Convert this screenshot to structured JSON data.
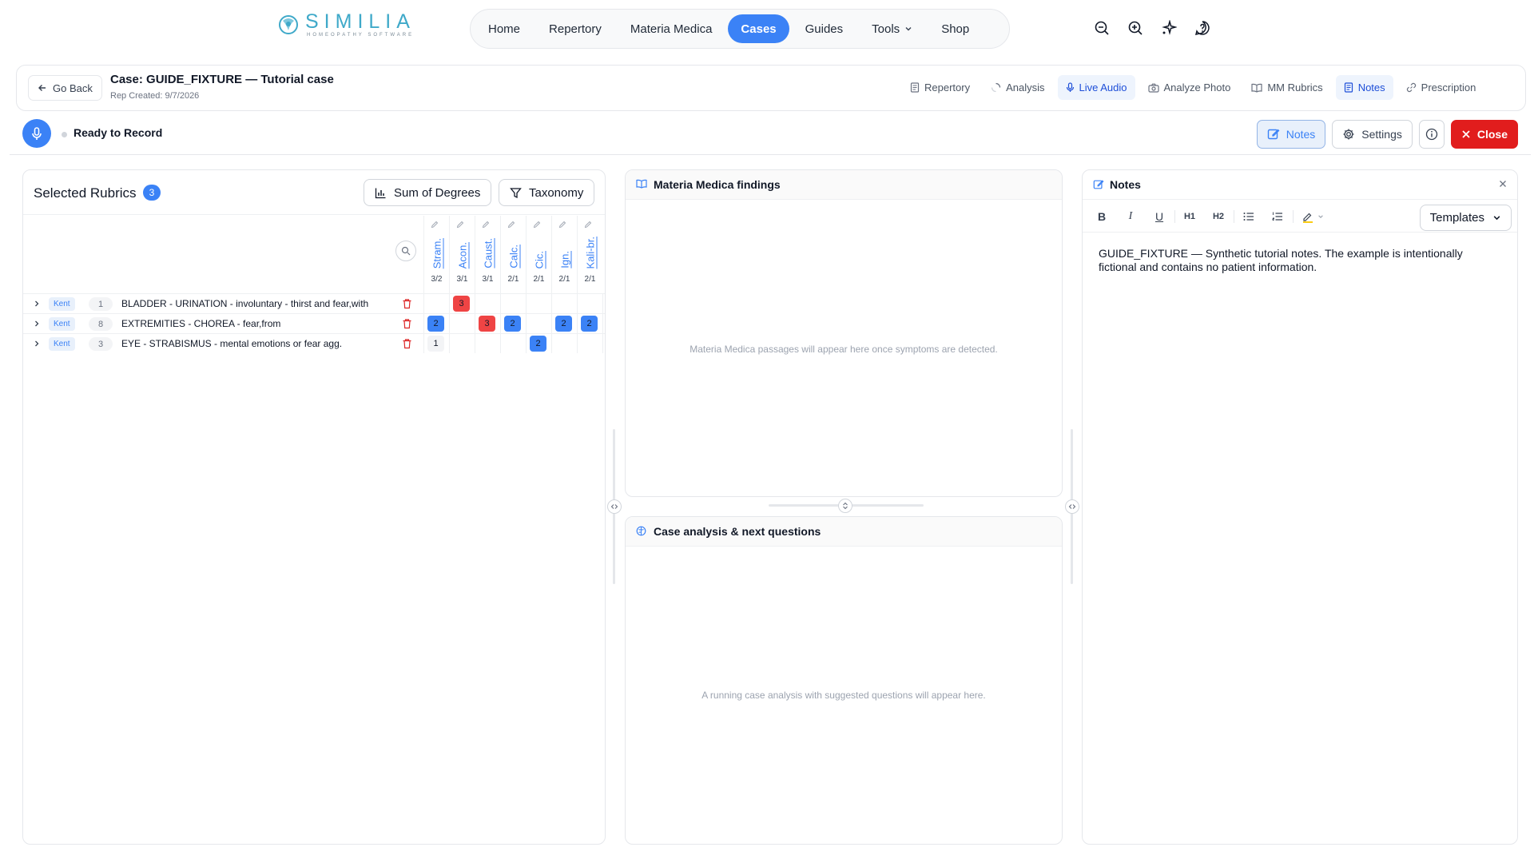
{
  "brand": {
    "name": "SIMILIA",
    "tagline": "HOMEOPATHY SOFTWARE"
  },
  "nav": {
    "items": [
      {
        "label": "Home",
        "active": false
      },
      {
        "label": "Repertory",
        "active": false
      },
      {
        "label": "Materia Medica",
        "active": false
      },
      {
        "label": "Cases",
        "active": true
      },
      {
        "label": "Guides",
        "active": false
      },
      {
        "label": "Tools",
        "active": false,
        "dropdown": true
      },
      {
        "label": "Shop",
        "active": false
      }
    ],
    "icons": [
      "zoom-out-icon",
      "zoom-in-icon",
      "sparkle-icon",
      "help-icon"
    ]
  },
  "case": {
    "back_label": "Go Back",
    "title": "Case: GUIDE_FIXTURE — Tutorial case",
    "subtitle": "Rep Created: 9/7/2026",
    "tabs": [
      {
        "label": "Repertory",
        "icon": "document-icon",
        "active": false
      },
      {
        "label": "Analysis",
        "icon": "spinner-icon",
        "active": false
      },
      {
        "label": "Live Audio",
        "icon": "microphone-icon",
        "active": true
      },
      {
        "label": "Analyze Photo",
        "icon": "camera-icon",
        "active": false
      },
      {
        "label": "MM Rubrics",
        "icon": "book-icon",
        "active": false
      },
      {
        "label": "Notes",
        "icon": "document-icon",
        "active": true
      },
      {
        "label": "Prescription",
        "icon": "link-icon",
        "active": false
      }
    ]
  },
  "record": {
    "status": "Ready to Record",
    "notes_label": "Notes",
    "settings_label": "Settings",
    "close_label": "Close"
  },
  "rubrics": {
    "title": "Selected Rubrics",
    "count": "3",
    "sum_label": "Sum of Degrees",
    "taxonomy_label": "Taxonomy",
    "remedies": [
      {
        "name": "Stram.",
        "score": "3/2"
      },
      {
        "name": "Acon.",
        "score": "3/1"
      },
      {
        "name": "Caust.",
        "score": "3/1"
      },
      {
        "name": "Calc.",
        "score": "2/1"
      },
      {
        "name": "Cic.",
        "score": "2/1"
      },
      {
        "name": "Ign.",
        "score": "2/1"
      },
      {
        "name": "Kali-br.",
        "score": "2/1"
      }
    ],
    "rows": [
      {
        "source": "Kent",
        "num": "1",
        "text": "BLADDER - URINATION - involuntary - thirst and fear,with",
        "grades": [
          "",
          "3",
          "",
          "",
          "",
          "",
          ""
        ]
      },
      {
        "source": "Kent",
        "num": "8",
        "text": "EXTREMITIES - CHOREA - fear,from",
        "grades": [
          "2",
          "",
          "3",
          "2",
          "",
          "2",
          "2"
        ]
      },
      {
        "source": "Kent",
        "num": "3",
        "text": "EYE - STRABISMUS - mental emotions or fear agg.",
        "grades": [
          "1",
          "",
          "",
          "",
          "2",
          "",
          ""
        ]
      }
    ],
    "grade_colors": {
      "1": "#f3f4f6",
      "2": "#3b82f6",
      "3": "#ef4444"
    }
  },
  "materia_medica": {
    "title": "Materia Medica findings",
    "placeholder": "Materia Medica passages will appear here once symptoms are detected."
  },
  "case_analysis": {
    "title": "Case analysis & next questions",
    "placeholder": "A running case analysis with suggested questions will appear here."
  },
  "notes": {
    "title": "Notes",
    "templates_label": "Templates",
    "toolbar": {
      "bold": "B",
      "italic": "I",
      "underline": "U",
      "h1": "H1",
      "h2": "H2"
    },
    "body": "GUIDE_FIXTURE — Synthetic tutorial notes. The example is intentionally fictional and contains no patient information."
  },
  "colors": {
    "accent": "#3b82f6",
    "danger": "#e11d1d",
    "brand": "#3fa9c9"
  }
}
